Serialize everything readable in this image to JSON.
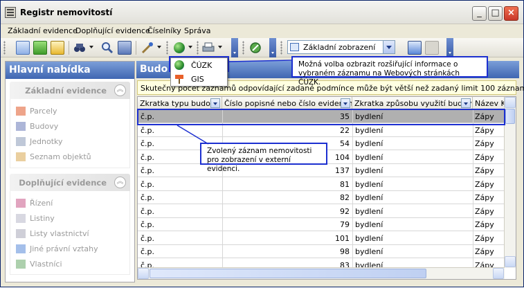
{
  "window": {
    "title": "Registr nemovitostí"
  },
  "window_buttons": [
    "_",
    "□",
    "×"
  ],
  "menu": [
    {
      "label": "Základní evidence"
    },
    {
      "label": "Doplňující evidence"
    },
    {
      "label": "Číselníky"
    },
    {
      "label": "Správa"
    }
  ],
  "toolbar": {
    "view_select_value": "Základní zobrazení"
  },
  "dropdown_menu": {
    "items": [
      {
        "label": "ČÚZK",
        "icon": "globe-icon"
      },
      {
        "label": "GIS",
        "icon": "map-sign-icon"
      }
    ]
  },
  "sidebar": {
    "title": "Hlavní nabídka",
    "groups": [
      {
        "title": "Základní evidence",
        "items": [
          "Parcely",
          "Budovy",
          "Jednotky",
          "Seznam objektů"
        ]
      },
      {
        "title": "Doplňující evidence",
        "items": [
          "Řízení",
          "Listiny",
          "Listy vlastnictví",
          "Jiné právní vztahy",
          "Vlastníci"
        ]
      }
    ]
  },
  "main": {
    "title_partial": "Budo",
    "info_message": "Skutečný počet záznamů odpovídající zadané podmínce může být větší než zadaný limit 100 záznamů."
  },
  "table": {
    "columns": [
      "Zkratka typu budovy",
      "Číslo popisné nebo číslo evidenční",
      "Zkratka způsobu využití budovy",
      "Název K"
    ],
    "rows": [
      {
        "typ": "č.p.",
        "cislo": "35",
        "vyuziti": "bydlení",
        "nazev": "Zápy"
      },
      {
        "typ": "č.p.",
        "cislo": "22",
        "vyuziti": "bydlení",
        "nazev": "Zápy"
      },
      {
        "typ": "č.p.",
        "cislo": "54",
        "vyuziti": "bydlení",
        "nazev": "Zápy"
      },
      {
        "typ": "č.p.",
        "cislo": "104",
        "vyuziti": "bydlení",
        "nazev": "Zápy"
      },
      {
        "typ": "č.p.",
        "cislo": "137",
        "vyuziti": "bydlení",
        "nazev": "Zápy"
      },
      {
        "typ": "č.p.",
        "cislo": "81",
        "vyuziti": "bydlení",
        "nazev": "Zápy"
      },
      {
        "typ": "č.p.",
        "cislo": "82",
        "vyuziti": "bydlení",
        "nazev": "Zápy"
      },
      {
        "typ": "č.p.",
        "cislo": "92",
        "vyuziti": "bydlení",
        "nazev": "Zápy"
      },
      {
        "typ": "č.p.",
        "cislo": "79",
        "vyuziti": "bydlení",
        "nazev": "Zápy"
      },
      {
        "typ": "č.p.",
        "cislo": "101",
        "vyuziti": "bydlení",
        "nazev": "Zápy"
      },
      {
        "typ": "č.p.",
        "cislo": "98",
        "vyuziti": "bydlení",
        "nazev": "Zápy"
      },
      {
        "typ": "č.p.",
        "cislo": "83",
        "vyuziti": "bydlení",
        "nazev": "Zápy"
      }
    ],
    "selected_row": 0
  },
  "callouts": {
    "cuzk": "Možná volba ozbrazit rozšiřující informace o vybraném záznamu na Webových stránkách ČÚZK.",
    "record": "Zvolený záznam nemovitosti pro zobrazení v externí evidenci."
  },
  "colors": {
    "header_blue": "#3f66b2",
    "callout_border": "#1c2fd0",
    "info_bg": "#ffffe1",
    "selected_row": "#b0b0b0"
  }
}
